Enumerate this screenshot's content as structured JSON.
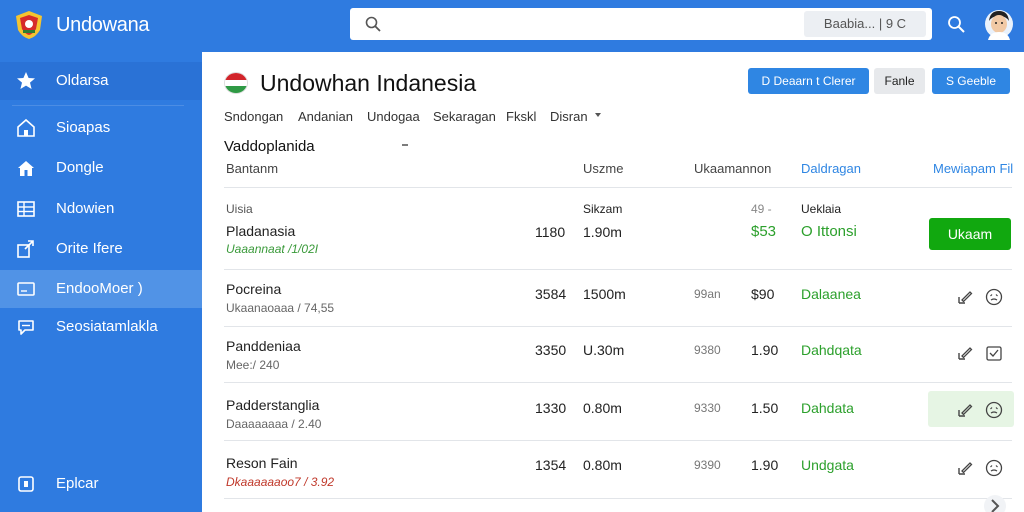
{
  "app": {
    "title": "Undowana"
  },
  "search": {
    "placeholder": "",
    "chip_text": "Baabia... | 9 C"
  },
  "sidebar": {
    "items": [
      {
        "label": "Oldarsa",
        "icon": "star-icon"
      },
      {
        "label": "Sioapas",
        "icon": "home-icon"
      },
      {
        "label": "Dongle",
        "icon": "house-icon"
      },
      {
        "label": "Ndowien",
        "icon": "grid-icon"
      },
      {
        "label": "Orite Ifere",
        "icon": "share-icon"
      },
      {
        "label": "EndooMoer )",
        "icon": "card-icon"
      },
      {
        "label": "Seosiatamlakla",
        "icon": "chat-icon"
      },
      {
        "label": "Eplcar",
        "icon": "logout-icon"
      }
    ]
  },
  "header": {
    "title": "Undowhan Indanesia",
    "buttons": {
      "primary": "D Deaarn t Clerer",
      "secondary": "Fanle",
      "tertiary": "S Geeble"
    }
  },
  "tabs": [
    "Sndongan",
    "Andanian",
    "Undogaa",
    "Sekaragan",
    "Fkskl",
    "Disran"
  ],
  "filter": {
    "title": "Vaddoplanida"
  },
  "columns": {
    "name": "Bantanm",
    "size": "Uszme",
    "amount": "Ukaamannon",
    "status": "Daldragan",
    "action": "Mewiapam Fil"
  },
  "rows": [
    {
      "name": "Pladanasia",
      "label_top": "Uisia",
      "sub": "Uaaannaat /1/02I",
      "qty": "1180",
      "size_top": "Sikzam",
      "size": "1.90m",
      "amount_top": "49 -",
      "amount": "$53",
      "status_top": "Ueklaia",
      "status": "O Ittonsi",
      "action": "Ukaam"
    },
    {
      "name": "Pocreina",
      "sub": "Ukaanaoaaa / 74,55",
      "qty": "3584",
      "size": "1500m",
      "amount_muted": "99an",
      "amount": "$90",
      "status": "Dalaanea"
    },
    {
      "name": "Panddeniaa",
      "sub": "Mee:/ 240",
      "qty": "3350",
      "size": "U.30m",
      "amount_muted": "9380",
      "amount": "1.90",
      "status": "Dahdqata"
    },
    {
      "name": "Padderstanglia",
      "sub": "Daaaaaaaa / 2.40",
      "qty": "1330",
      "size": "0.80m",
      "amount_muted": "9330",
      "amount": "1.50",
      "status": "Dahdata"
    },
    {
      "name": "Reson Fain",
      "sub": "Dkaaaaaaoo7 / 3.92",
      "qty": "1354",
      "size": "0.80m",
      "amount_muted": "9390",
      "amount": "1.90",
      "status": "Undgata"
    }
  ],
  "colors": {
    "brand": "#2f7be0",
    "active_item": "#5193e6",
    "accent_green": "#11a80f",
    "link_blue": "#2f86e3"
  }
}
